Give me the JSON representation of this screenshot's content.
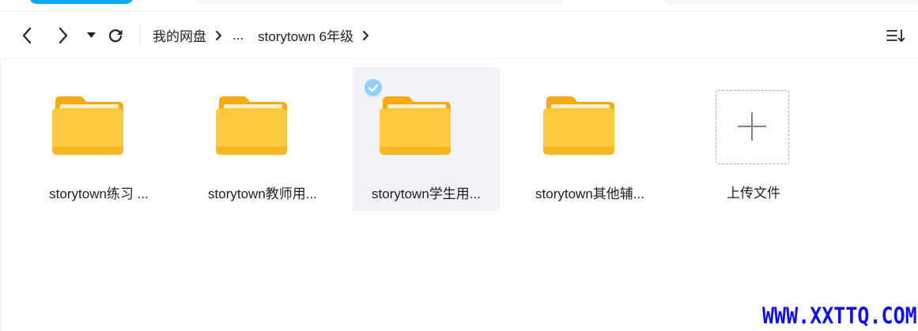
{
  "nav": {
    "back_icon": "chevron-left-icon",
    "forward_icon": "chevron-right-icon",
    "history_icon": "caret-down-icon",
    "refresh_icon": "refresh-icon",
    "sort_icon": "sort-list-icon"
  },
  "breadcrumb": {
    "root": "我的网盘",
    "ellipsis": "...",
    "current": "storytown 6年级"
  },
  "items": [
    {
      "label": "storytown练习 ...",
      "type": "folder",
      "selected": false
    },
    {
      "label": "storytown教师用...",
      "type": "folder",
      "selected": false
    },
    {
      "label": "storytown学生用...",
      "type": "folder",
      "selected": true
    },
    {
      "label": "storytown其他辅...",
      "type": "folder",
      "selected": false
    }
  ],
  "upload": {
    "label": "上传文件",
    "icon": "plus-icon"
  },
  "watermark": "WWW.XXTTQ.COM",
  "colors": {
    "accent": "#06a7ff",
    "folder_body": "#ffc83d",
    "folder_back": "#f5a912",
    "selected_bg": "#f2f3f8",
    "check": "#8fd0ff",
    "watermark": "#1010ee"
  }
}
